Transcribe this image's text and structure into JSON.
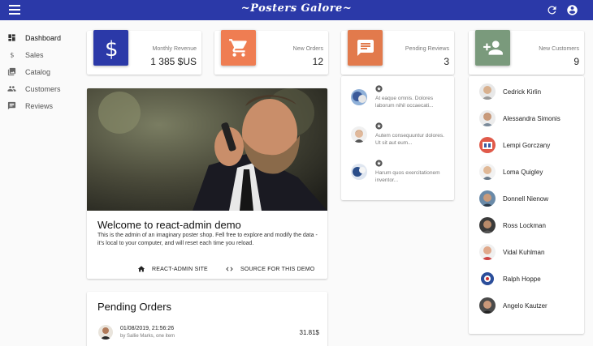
{
  "app": {
    "title": "~Posters Galore~",
    "accent": "#2b39a8"
  },
  "sidebar": {
    "items": [
      {
        "label": "Dashboard",
        "icon": "dashboard-icon",
        "active": true
      },
      {
        "label": "Sales",
        "icon": "dollar-icon",
        "active": false
      },
      {
        "label": "Catalog",
        "icon": "collections-icon",
        "active": false
      },
      {
        "label": "Customers",
        "icon": "people-icon",
        "active": false
      },
      {
        "label": "Reviews",
        "icon": "comment-icon",
        "active": false
      }
    ]
  },
  "stats": [
    {
      "label": "Monthly Revenue",
      "value": "1 385 $US",
      "icon": "dollar-icon",
      "color": "#2b39a8"
    },
    {
      "label": "New Orders",
      "value": "12",
      "icon": "cart-icon",
      "color": "#ef7d52"
    },
    {
      "label": "Pending Reviews",
      "value": "3",
      "icon": "comment-icon",
      "color": "#e27a4c"
    },
    {
      "label": "New Customers",
      "value": "9",
      "icon": "person-add-icon",
      "color": "#7a9a7c"
    }
  ],
  "welcome": {
    "title": "Welcome to react-admin demo",
    "text": "This is the admin of an imaginary poster shop. Fell free to explore and modify the data - it's local to your computer, and will reset each time you reload.",
    "button_site": "REACT-ADMIN SITE",
    "button_source": "SOURCE FOR THIS DEMO"
  },
  "pending_orders": {
    "title": "Pending Orders",
    "rows": [
      {
        "date": "01/08/2019, 21:56:26",
        "subtitle": "by Sallie Marks, one item",
        "amount": "31.81$"
      }
    ]
  },
  "reviews": [
    {
      "text": "At eaque omnis. Dolores laborum nihil occaecati..."
    },
    {
      "text": "Autem consequuntur dolores. Ut sit aut eum..."
    },
    {
      "text": "Harum quos exercitationem inventor..."
    }
  ],
  "customers": [
    {
      "name": "Cedrick Kirlin"
    },
    {
      "name": "Alessandra Simonis"
    },
    {
      "name": "Lempi Gorczany"
    },
    {
      "name": "Loma Quigley"
    },
    {
      "name": "Donnell Nienow"
    },
    {
      "name": "Ross Lockman"
    },
    {
      "name": "Vidal Kuhlman"
    },
    {
      "name": "Ralph Hoppe"
    },
    {
      "name": "Angelo Kautzer"
    }
  ]
}
